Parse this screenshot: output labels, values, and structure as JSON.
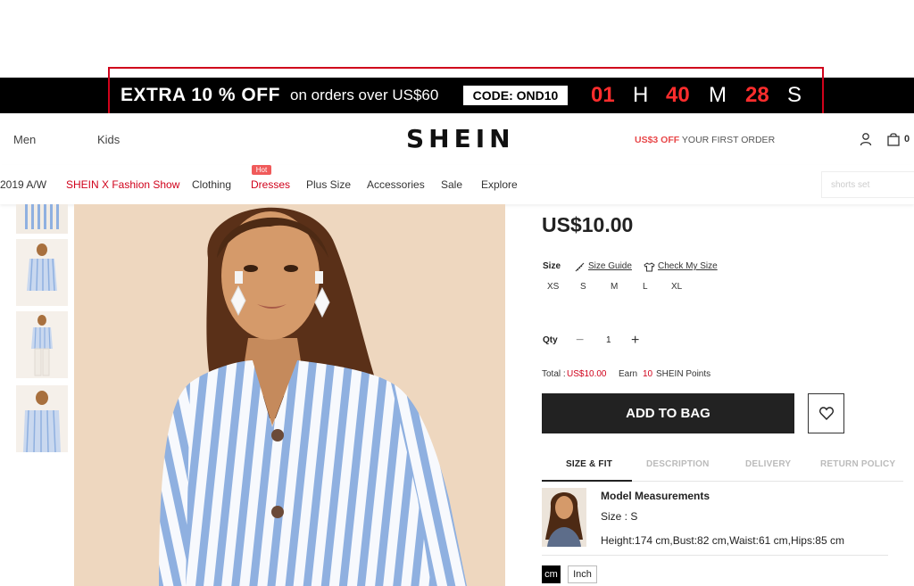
{
  "promo": {
    "main": "EXTRA 10 % OFF",
    "sub": "on orders over US$60",
    "code": "CODE: OND10",
    "countdown": {
      "hours": "01",
      "h": "H",
      "minutes": "40",
      "m": "M",
      "seconds": "28",
      "s": "S"
    }
  },
  "header": {
    "nav_men": "Men",
    "nav_kids": "Kids",
    "logo": "SHEIN",
    "first_order_offer": "US$3 OFF",
    "first_order_text": " YOUR FIRST ORDER",
    "bag_count": "0"
  },
  "categories": {
    "aw": "2019 A/W",
    "fashion_show": "SHEIN X Fashion Show",
    "clothing": "Clothing",
    "dresses": "Dresses",
    "hot": "Hot",
    "plus_size": "Plus Size",
    "accessories": "Accessories",
    "sale": "Sale",
    "explore": "Explore"
  },
  "search": {
    "placeholder": "shorts set"
  },
  "product": {
    "price": "US$10.00",
    "size_label": "Size",
    "size_guide": "Size Guide",
    "check_my_size": "Check My Size",
    "sizes": [
      "XS",
      "S",
      "M",
      "L",
      "XL"
    ],
    "qty_label": "Qty",
    "qty_minus": "−",
    "qty_value": "1",
    "qty_plus": "+",
    "total_label": "Total : ",
    "total_value": "US$10.00",
    "earn_label": "Earn",
    "earn_points": "10",
    "points_label": "SHEIN Points",
    "add_to_bag": "ADD TO BAG"
  },
  "tabs": [
    "SIZE & FIT",
    "DESCRIPTION",
    "DELIVERY",
    "RETURN POLICY"
  ],
  "model": {
    "title": "Model Measurements",
    "size": "Size : S",
    "measurements": "Height:174 cm,Bust:82 cm,Waist:61 cm,Hips:85 cm"
  },
  "units": {
    "cm": "cm",
    "inch": "Inch"
  },
  "colors": {
    "accent_red": "#d0021b",
    "countdown_red": "#ff2d2d",
    "button_dark": "#222222",
    "stripe_blue": "#8fb0e0"
  }
}
